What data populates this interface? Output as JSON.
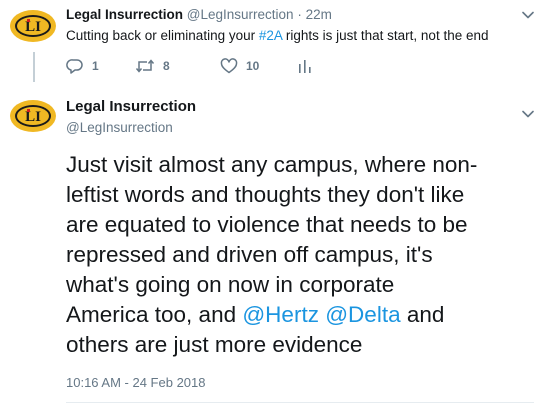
{
  "tweet1": {
    "name": "Legal Insurrection",
    "handle": "@LegInsurrection",
    "separator": "·",
    "time": "22m",
    "text_before": "Cutting back or eliminating your ",
    "hashtag": "#2A",
    "text_after": " rights is just that start, not the end",
    "reply_count": "1",
    "retweet_count": "8",
    "like_count": "10"
  },
  "tweet2": {
    "name": "Legal Insurrection",
    "handle": "@LegInsurrection",
    "lines": [
      "Just visit almost any campus, where non-",
      "leftist words and thoughts they don't like",
      "are equated to violence that needs to be",
      "repressed and driven off campus, it's",
      "what's going on now in corporate"
    ],
    "line6_before": "America too, and ",
    "mention1": "@Hertz",
    "line6_space": " ",
    "mention2": "@Delta",
    "line6_after": " and",
    "line7": "others are just more evidence",
    "timestamp": "10:16 AM - 24 Feb 2018"
  },
  "avatar": {
    "letters": "LI",
    "colors": {
      "outer": "#f0b823",
      "inner": "#d41f1f",
      "letters": "#1a1a1a"
    }
  },
  "colors": {
    "link": "#1b95e0",
    "secondary_text": "#657786",
    "primary_text": "#14171a"
  }
}
